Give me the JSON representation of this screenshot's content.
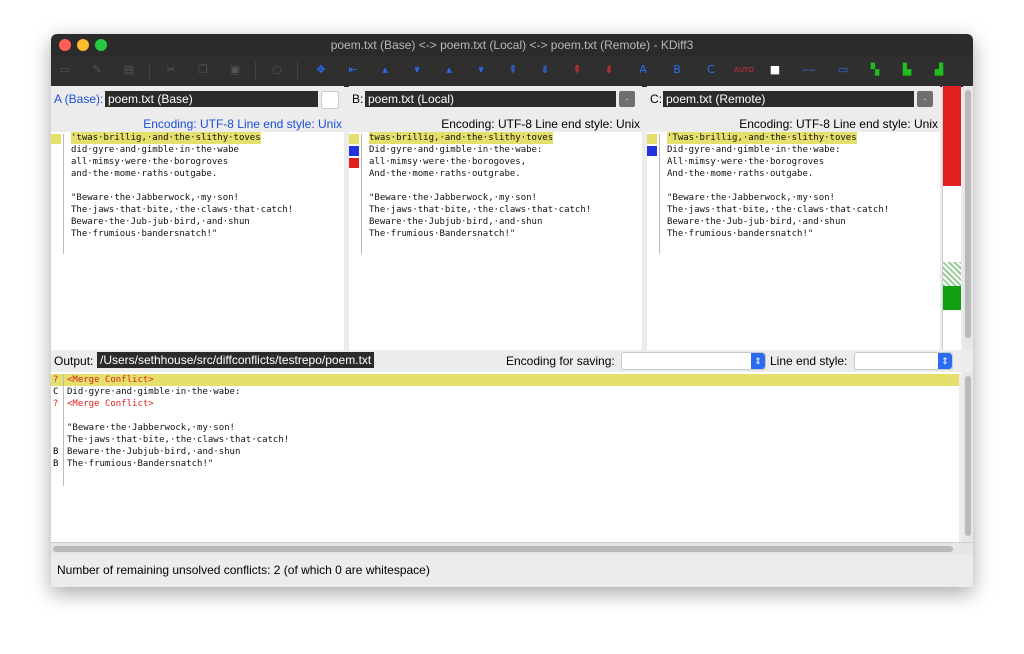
{
  "window": {
    "title": "poem.txt (Base) <-> poem.txt (Local) <-> poem.txt (Remote) - KDiff3"
  },
  "toolbar": {
    "icons": [
      "new-icon",
      "open-icon",
      "save-icon",
      "cut-icon",
      "copy-icon",
      "paste-icon",
      "find-icon",
      "goto-current-icon",
      "goto-top-icon",
      "goto-prev-delta-icon",
      "goto-next-delta-icon",
      "goto-prev-conflict-icon",
      "goto-next-conflict-icon",
      "goto-prev-unsolved-icon",
      "goto-next-unsolved-icon",
      "goto-bottom-icon",
      "select-a-icon",
      "select-b-icon",
      "select-c-icon",
      "auto-solve-icon",
      "show-whitespace-icon",
      "show-line-numbers-icon",
      "toggle-overview-icon",
      "split-icon",
      "overview-ab-icon",
      "overview-c-icon"
    ],
    "labels": {
      "a": "A",
      "b": "B",
      "c": "C",
      "auto": "AUTO"
    }
  },
  "panes": {
    "a": {
      "label": "A (Base):",
      "file": "poem.txt (Base)",
      "encoding": "Encoding: UTF-8 Line end style: Unix",
      "lines": [
        "'twas·brillig,·and·the·slithy·toves",
        "did·gyre·and·gimble·in·the·wabe",
        "all·mimsy·were·the·borogroves",
        "and·the·mome·raths·outgabe.",
        "",
        "\"Beware·the·Jabberwock,·my·son!",
        "The·jaws·that·bite,·the·claws·that·catch!",
        "Beware·the·Jub-jub·bird,·and·shun",
        "The·frumious·bandersnatch!\""
      ]
    },
    "b": {
      "label": "B:",
      "file": "poem.txt (Local)",
      "encoding": "Encoding: UTF-8 Line end style: Unix",
      "lines": [
        "twas·brillig,·and·the·slithy·toves",
        "Did·gyre·and·gimble·in·the·wabe:",
        "all·mimsy·were·the·borogoves,",
        "And·the·mome·raths·outgrabe.",
        "",
        "\"Beware·the·Jabberwock,·my·son!",
        "The·jaws·that·bite,·the·claws·that·catch!",
        "Beware·the·Jubjub·bird,·and·shun",
        "The·frumious·Bandersnatch!\""
      ]
    },
    "c": {
      "label": "C:",
      "file": "poem.txt (Remote)",
      "encoding": "Encoding: UTF-8 Line end style: Unix",
      "lines": [
        "'Twas·brillig,·and·the·slithy·toves",
        "Did·gyre·and·gimble·in·the·wabe:",
        "All·mimsy·were·the·borogroves",
        "And·the·mome·raths·outgabe.",
        "",
        "\"Beware·the·Jabberwock,·my·son!",
        "The·jaws·that·bite,·the·claws·that·catch!",
        "Beware·the·Jub-jub·bird,·and·shun",
        "The·frumious·bandersnatch!\""
      ]
    }
  },
  "output": {
    "label": "Output:",
    "path": "/Users/sethhouse/src/diffconflicts/testrepo/poem.txt",
    "encoding_label": "Encoding for saving:",
    "encoding_value": "",
    "line_end_label": "Line end style:",
    "line_end_value": "",
    "lines": [
      {
        "g": "?",
        "t": "<Merge Conflict>",
        "conflict": true
      },
      {
        "g": "C",
        "t": "Did·gyre·and·gimble·in·the·wabe:",
        "conflict": false
      },
      {
        "g": "?",
        "t": "<Merge Conflict>",
        "conflict": true
      },
      {
        "g": "",
        "t": "",
        "conflict": false
      },
      {
        "g": "",
        "t": "\"Beware·the·Jabberwock,·my·son!",
        "conflict": false
      },
      {
        "g": "",
        "t": "The·jaws·that·bite,·the·claws·that·catch!",
        "conflict": false
      },
      {
        "g": "B",
        "t": "Beware·the·Jubjub·bird,·and·shun",
        "conflict": false
      },
      {
        "g": "B",
        "t": "The·frumious·Bandersnatch!\"",
        "conflict": false
      }
    ]
  },
  "status": {
    "text": "Number of remaining unsolved conflicts: 2 (of which 0 are whitespace)"
  },
  "colors": {
    "conflict_yellow": "#e4e06b",
    "conflict_red": "#e02020",
    "diff_blue": "#2233dd",
    "overview_green": "#10a010",
    "label_blue": "#1a4fd8"
  }
}
